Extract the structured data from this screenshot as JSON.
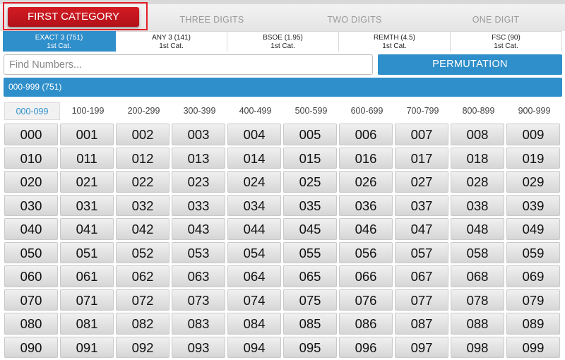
{
  "top_tabs": {
    "first": "FIRST CATEGORY",
    "three": "THREE DIGITS",
    "two": "TWO DIGITS",
    "one": "ONE DIGIT"
  },
  "sub_tabs": [
    {
      "title": "EXACT 3 (751)",
      "sub": "1st Cat."
    },
    {
      "title": "ANY 3 (141)",
      "sub": "1st Cat."
    },
    {
      "title": "BSOE (1.95)",
      "sub": "1st Cat."
    },
    {
      "title": "REMTH (4.5)",
      "sub": "1st Cat."
    },
    {
      "title": "FSC (90)",
      "sub": "1st Cat."
    }
  ],
  "search": {
    "placeholder": "Find Numbers..."
  },
  "permutation_label": "PERMUTATION",
  "range_bar": "000-999 (751)",
  "range_tabs": [
    "000-099",
    "100-199",
    "200-299",
    "300-399",
    "400-499",
    "500-599",
    "600-699",
    "700-799",
    "800-899",
    "900-999"
  ],
  "numbers": [
    "000",
    "001",
    "002",
    "003",
    "004",
    "005",
    "006",
    "007",
    "008",
    "009",
    "010",
    "011",
    "012",
    "013",
    "014",
    "015",
    "016",
    "017",
    "018",
    "019",
    "020",
    "021",
    "022",
    "023",
    "024",
    "025",
    "026",
    "027",
    "028",
    "029",
    "030",
    "031",
    "032",
    "033",
    "034",
    "035",
    "036",
    "037",
    "038",
    "039",
    "040",
    "041",
    "042",
    "043",
    "044",
    "045",
    "046",
    "047",
    "048",
    "049",
    "050",
    "051",
    "052",
    "053",
    "054",
    "055",
    "056",
    "057",
    "058",
    "059",
    "060",
    "061",
    "062",
    "063",
    "064",
    "065",
    "066",
    "067",
    "068",
    "069",
    "070",
    "071",
    "072",
    "073",
    "074",
    "075",
    "076",
    "077",
    "078",
    "079",
    "080",
    "081",
    "082",
    "083",
    "084",
    "085",
    "086",
    "087",
    "088",
    "089",
    "090",
    "091",
    "092",
    "093",
    "094",
    "095",
    "096",
    "097",
    "098",
    "099"
  ]
}
